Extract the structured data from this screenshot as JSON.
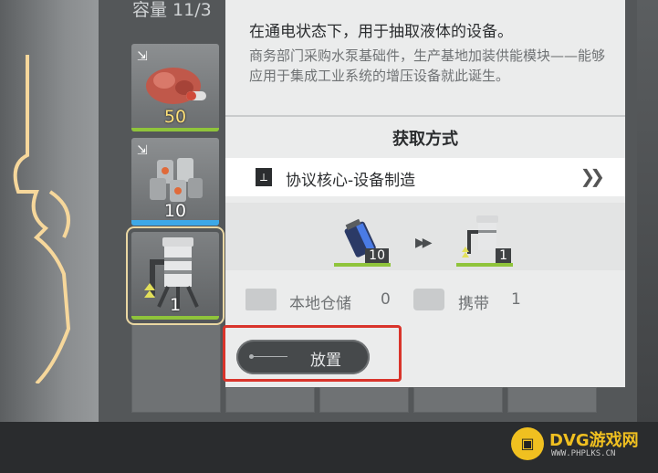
{
  "inventory": {
    "capacity_label": "容量 11/3",
    "slots": [
      {
        "count": "50",
        "bar_color": "#8fc43b",
        "item": "raw-ore-chunk"
      },
      {
        "count": "10",
        "bar_color": "#3ea8e6",
        "item": "metal-canisters"
      },
      {
        "count": "1",
        "bar_color": "#8fc43b",
        "item": "water-pump"
      }
    ]
  },
  "detail": {
    "summary": "在通电状态下，用于抽取液体的设备。",
    "description": "商务部门采购水泵基础件，生产基地加装供能模块——能够应用于集成工业系统的增压设备就此诞生。",
    "acquisition_title": "获取方式",
    "acquisition_method": "协议核心-设备制造",
    "recipe": {
      "input_count": "10",
      "output_count": "1"
    },
    "stock": {
      "local_storage_label": "本地仓储",
      "local_storage_value": "0",
      "carried_label": "携带",
      "carried_value": "1"
    },
    "place_button_label": "放置"
  },
  "watermark": {
    "brand": "DVG游戏网",
    "url": "WWW.PHPLKS.CN"
  },
  "colors": {
    "highlight": "#d9342b",
    "panel": "#ebecec",
    "accent_green": "#8fc43b",
    "accent_blue": "#3ea8e6"
  }
}
